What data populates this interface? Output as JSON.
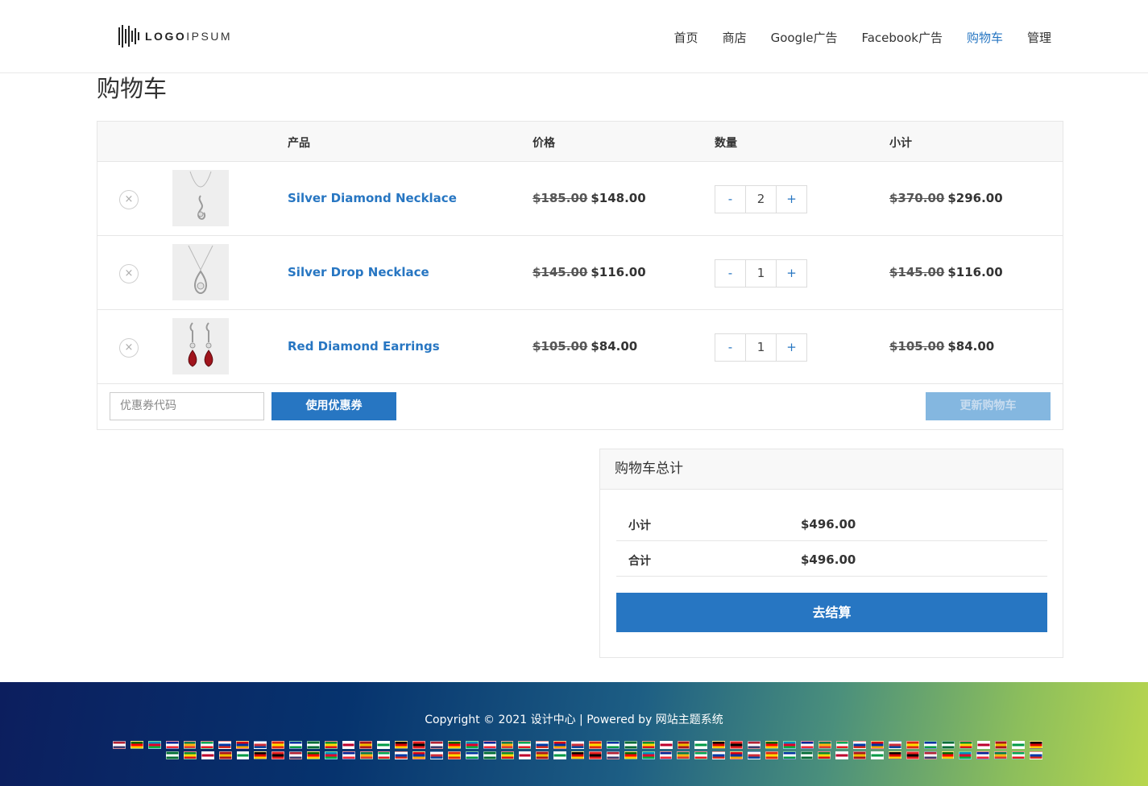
{
  "header": {
    "logo_text_bold": "LOGO",
    "logo_text_light": "IPSUM",
    "nav": [
      {
        "label": "首页",
        "active": false
      },
      {
        "label": "商店",
        "active": false
      },
      {
        "label": "Google广告",
        "active": false
      },
      {
        "label": "Facebook广告",
        "active": false
      },
      {
        "label": "购物车",
        "active": true
      },
      {
        "label": "管理",
        "active": false
      }
    ]
  },
  "page": {
    "title": "购物车"
  },
  "cart": {
    "columns": {
      "product": "产品",
      "price": "价格",
      "quantity": "数量",
      "subtotal": "小计"
    },
    "items": [
      {
        "name": "Silver Diamond Necklace",
        "old_price": "$185.00",
        "price": "$148.00",
        "qty": "2",
        "old_subtotal": "$370.00",
        "subtotal": "$296.00",
        "image_icon": "necklace-icon"
      },
      {
        "name": "Silver Drop Necklace",
        "old_price": "$145.00",
        "price": "$116.00",
        "qty": "1",
        "old_subtotal": "$145.00",
        "subtotal": "$116.00",
        "image_icon": "necklace-icon"
      },
      {
        "name": "Red Diamond Earrings",
        "old_price": "$105.00",
        "price": "$84.00",
        "qty": "1",
        "old_subtotal": "$105.00",
        "subtotal": "$84.00",
        "image_icon": "earrings-icon"
      }
    ],
    "remove_symbol": "×",
    "minus_label": "-",
    "plus_label": "+",
    "coupon_placeholder": "优惠券代码",
    "coupon_button": "使用优惠券",
    "update_button": "更新购物车"
  },
  "totals": {
    "title": "购物车总计",
    "subtotal_label": "小计",
    "subtotal_value": "$496.00",
    "total_label": "合计",
    "total_value": "$496.00",
    "checkout_button": "去结算"
  },
  "footer": {
    "copyright_prefix": "Copyright © 2021 ",
    "site_name": "设计中心",
    "powered_by": " | Powered by ",
    "theme_name": "网站主题系统",
    "language_flags_icon": "language-flag-icon"
  },
  "colors": {
    "accent": "#2776c2",
    "update_disabled": "#84b7e0"
  }
}
